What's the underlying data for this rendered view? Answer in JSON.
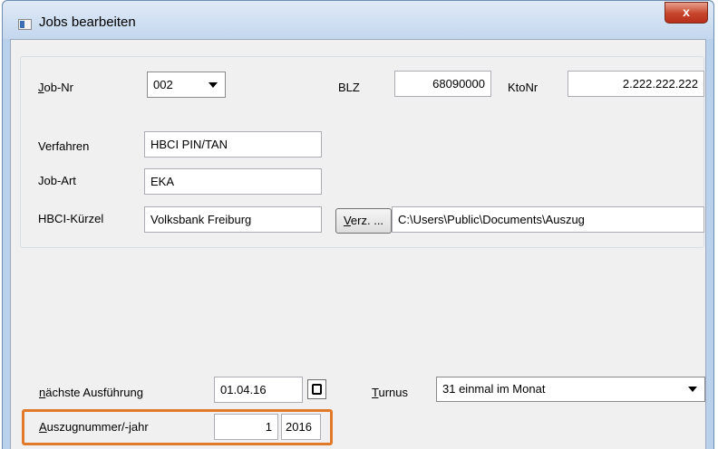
{
  "window": {
    "title": "Jobs bearbeiten",
    "close_glyph": "x"
  },
  "form": {
    "jobnr": {
      "label_first": "J",
      "label_rest": "ob-Nr",
      "value": "002"
    },
    "blz": {
      "label": "BLZ",
      "value": "68090000"
    },
    "ktonr": {
      "label": "KtoNr",
      "value": "2.222.222.222"
    },
    "verfahren": {
      "label": "Verfahren",
      "value": "HBCI PIN/TAN"
    },
    "jobart": {
      "label": "Job-Art",
      "value": "EKA"
    },
    "hbci": {
      "label": "HBCI-Kürzel",
      "value": "Volksbank Freiburg"
    },
    "verz": {
      "button_first": "V",
      "button_rest": "erz. ...",
      "path": "C:\\Users\\Public\\Documents\\Auszug"
    },
    "naechste": {
      "label_first": "n",
      "label_rest": "ächste Ausführung",
      "value": "01.04.16"
    },
    "turnus": {
      "label_first": "T",
      "label_rest": "urnus",
      "value": "31 einmal im Monat"
    },
    "auszug": {
      "label_first": "A",
      "label_rest": "uszugnummer/-jahr",
      "nummer": "1",
      "jahr": "2016"
    }
  },
  "colors": {
    "highlight": "#e07a2a",
    "close": "#c7442b",
    "frame": "#b9d1ea"
  },
  "icons": [
    "app-icon",
    "close-icon",
    "dropdown-arrow-icon",
    "calendar-icon"
  ]
}
